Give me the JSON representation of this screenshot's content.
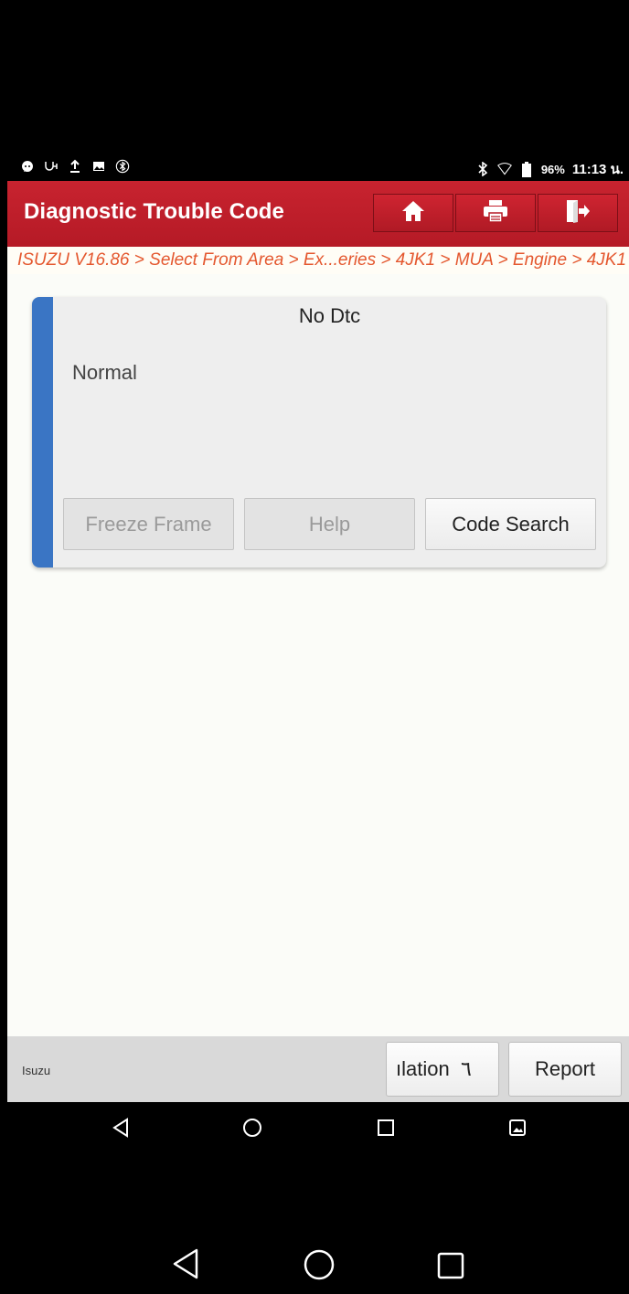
{
  "status_bar": {
    "left_icons": [
      "message-icon",
      "usb-debug-icon",
      "upload-icon",
      "image-icon",
      "bluetooth-ring-icon"
    ],
    "battery": "96%",
    "time": "11:13 น."
  },
  "header": {
    "title": "Diagnostic Trouble Code",
    "buttons": [
      "home-icon",
      "print-icon",
      "exit-icon"
    ]
  },
  "breadcrumb": "ISUZU V16.86 > Select From Area > Ex...eries > 4JK1 > MUA > Engine > 4JK1",
  "card": {
    "title": "No Dtc",
    "status": "Normal",
    "buttons": {
      "freeze_frame": "Freeze Frame",
      "help": "Help",
      "code_search": "Code Search"
    }
  },
  "footer": {
    "label": "Isuzu",
    "translation_button": "ılation  ٦",
    "report_button": "Report"
  },
  "colors": {
    "header_red": "#c8232f",
    "accent_blue": "#3a75c4",
    "breadcrumb_orange": "#e4572e"
  }
}
